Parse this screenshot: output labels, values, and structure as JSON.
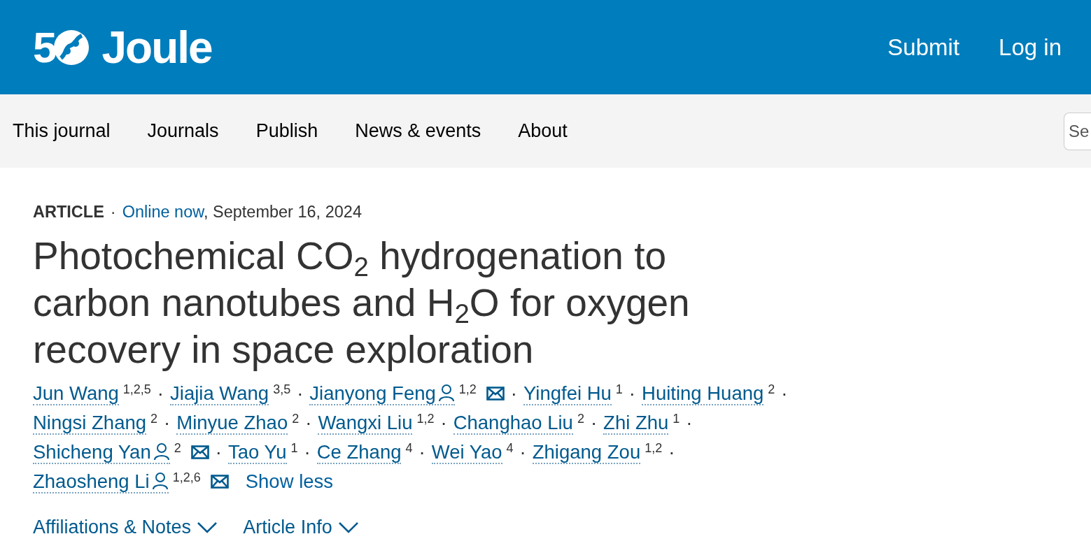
{
  "header": {
    "logo_number": "5",
    "logo_name": "Joule",
    "actions": [
      "Submit",
      "Log in"
    ]
  },
  "nav": {
    "items": [
      "This journal",
      "Journals",
      "Publish",
      "News & events",
      "About"
    ],
    "search": {
      "placeholder": "Se"
    }
  },
  "article": {
    "type": "ARTICLE",
    "status": "Online now",
    "date": ", September 16, 2024",
    "title": "Photochemical CO$_{2}$ hydrogenation to carbon nanotubes and H$_{2}$O for oxygen recovery in space exploration",
    "author_lines": [
      [
        {
          "name": "Jun Wang",
          "affiliations": "1,2,5",
          "corresponding": false
        },
        {
          "name": "Jiajia Wang",
          "affiliations": "3,5",
          "corresponding": false
        },
        {
          "name": "Jianyong Feng",
          "affiliations": "1,2",
          "corresponding": true
        },
        {
          "name": "Yingfei Hu",
          "affiliations": "1",
          "corresponding": false
        },
        {
          "name": "Huiting Huang",
          "affiliations": "2",
          "corresponding": false
        }
      ],
      [
        {
          "name": "Ningsi Zhang",
          "affiliations": "2",
          "corresponding": false
        },
        {
          "name": "Minyue Zhao",
          "affiliations": "2",
          "corresponding": false
        },
        {
          "name": "Wangxi Liu",
          "affiliations": "1,2",
          "corresponding": false
        },
        {
          "name": "Changhao Liu",
          "affiliations": "2",
          "corresponding": false
        },
        {
          "name": "Zhi Zhu",
          "affiliations": "1",
          "corresponding": false
        }
      ],
      [
        {
          "name": "Shicheng Yan",
          "affiliations": "2",
          "corresponding": true
        },
        {
          "name": "Tao Yu",
          "affiliations": "1",
          "corresponding": false
        },
        {
          "name": "Ce Zhang",
          "affiliations": "4",
          "corresponding": false
        },
        {
          "name": "Wei Yao",
          "affiliations": "4",
          "corresponding": false
        },
        {
          "name": "Zhigang Zou",
          "affiliations": "1,2",
          "corresponding": false
        }
      ],
      [
        {
          "name": "Zhaosheng Li",
          "affiliations": "1,2,6",
          "corresponding": true
        }
      ]
    ],
    "separator": "·",
    "show_less": "Show less",
    "sections": [
      {
        "label": "Affiliations & Notes",
        "expanded": false
      },
      {
        "label": "Article Info",
        "expanded": false
      }
    ]
  }
}
